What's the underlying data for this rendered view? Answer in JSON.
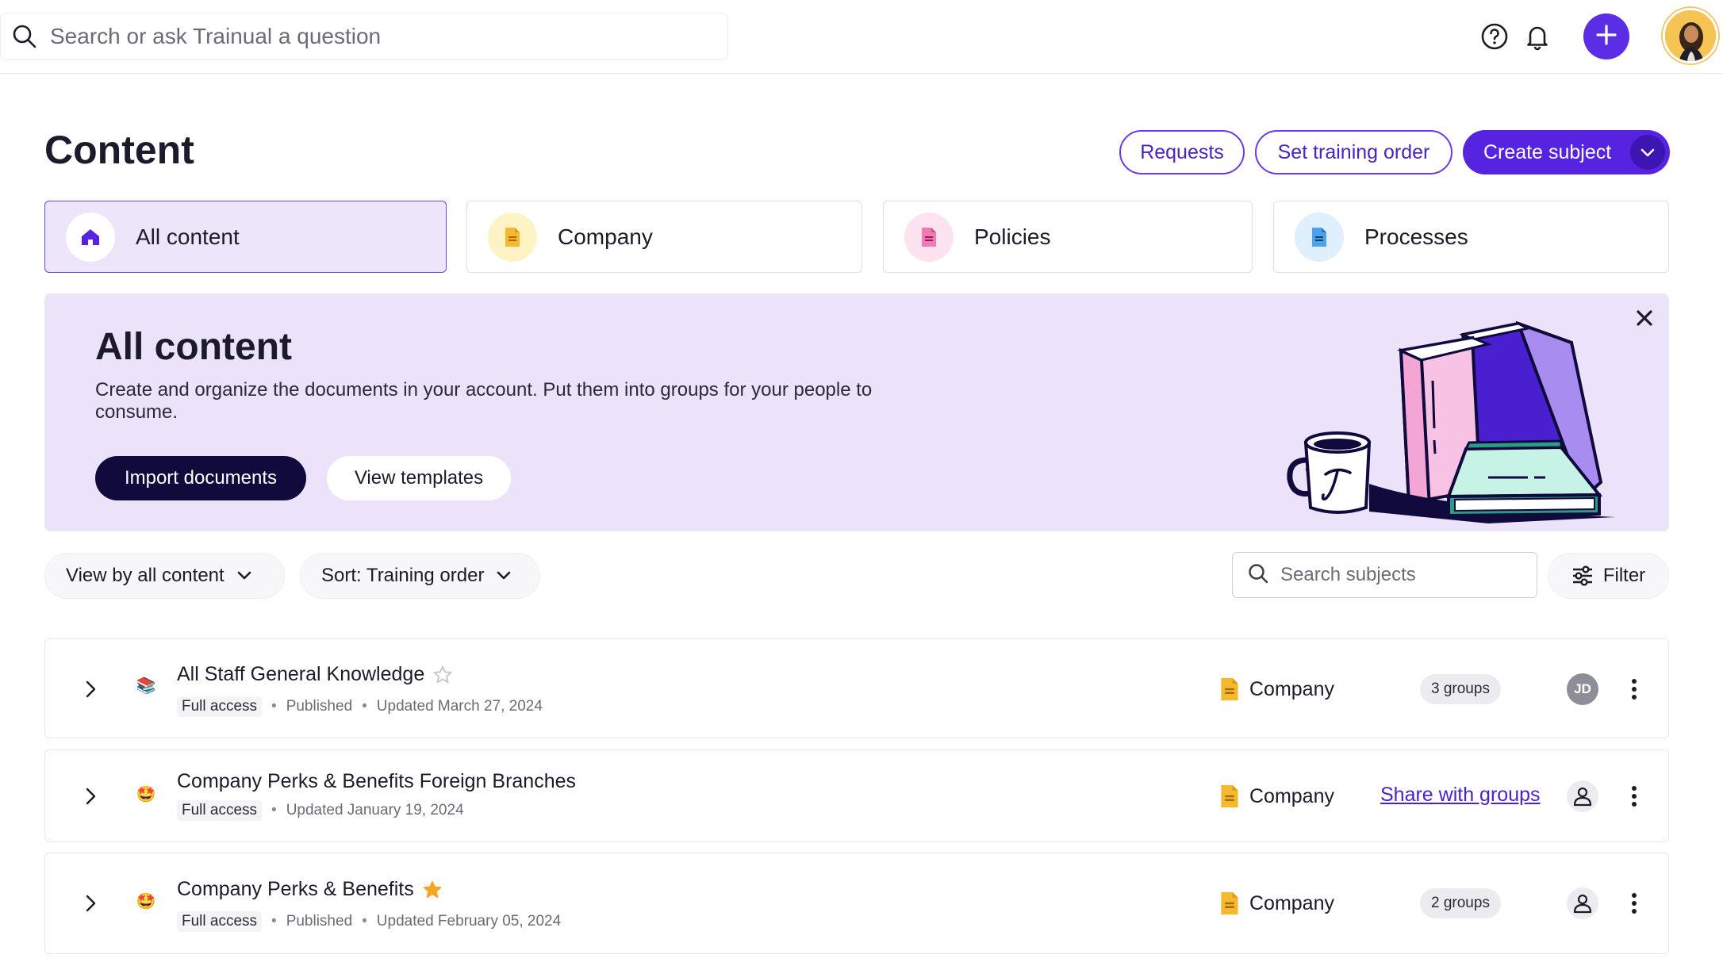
{
  "topbar": {
    "search_placeholder": "Search or ask Trainual a question",
    "icons": [
      "search-icon",
      "help-icon",
      "bell-icon",
      "plus-icon",
      "avatar"
    ]
  },
  "header": {
    "title": "Content",
    "requests_label": "Requests",
    "set_order_label": "Set training order",
    "create_label": "Create subject"
  },
  "tabs": [
    {
      "label": "All content",
      "icon": "home-icon",
      "active": true
    },
    {
      "label": "Company",
      "icon": "document-icon",
      "active": false
    },
    {
      "label": "Policies",
      "icon": "document-icon",
      "active": false
    },
    {
      "label": "Processes",
      "icon": "document-icon",
      "active": false
    }
  ],
  "banner": {
    "title": "All content",
    "description": "Create and organize the documents in your account. Put them into groups for your people to consume.",
    "import_label": "Import documents",
    "templates_label": "View templates"
  },
  "toolbar": {
    "view_label": "View by all content",
    "sort_label": "Sort: Training order",
    "search_placeholder": "Search subjects",
    "filter_label": "Filter"
  },
  "rows": [
    {
      "title": "All Staff General Knowledge",
      "emoji": "📚",
      "starred": false,
      "access": "Full access",
      "status": "Published",
      "updated": "Updated March 27, 2024",
      "category": "Company",
      "groups": "3 groups",
      "owner": "JD"
    },
    {
      "title": "Company Perks & Benefits Foreign Branches",
      "emoji": "🤩",
      "starred": false,
      "access": "Full access",
      "updated": "Updated January 19, 2024",
      "category": "Company",
      "share_label": "Share with groups"
    },
    {
      "title": "Company Perks & Benefits",
      "emoji": "🤩",
      "starred": true,
      "access": "Full access",
      "status": "Published",
      "updated": "Updated February 05, 2024",
      "category": "Company",
      "groups": "2 groups"
    }
  ],
  "colors": {
    "accent": "#5624e0",
    "banner_bg": "#ece3fa",
    "dark_button": "#110b3d",
    "star": "#f5a623"
  }
}
